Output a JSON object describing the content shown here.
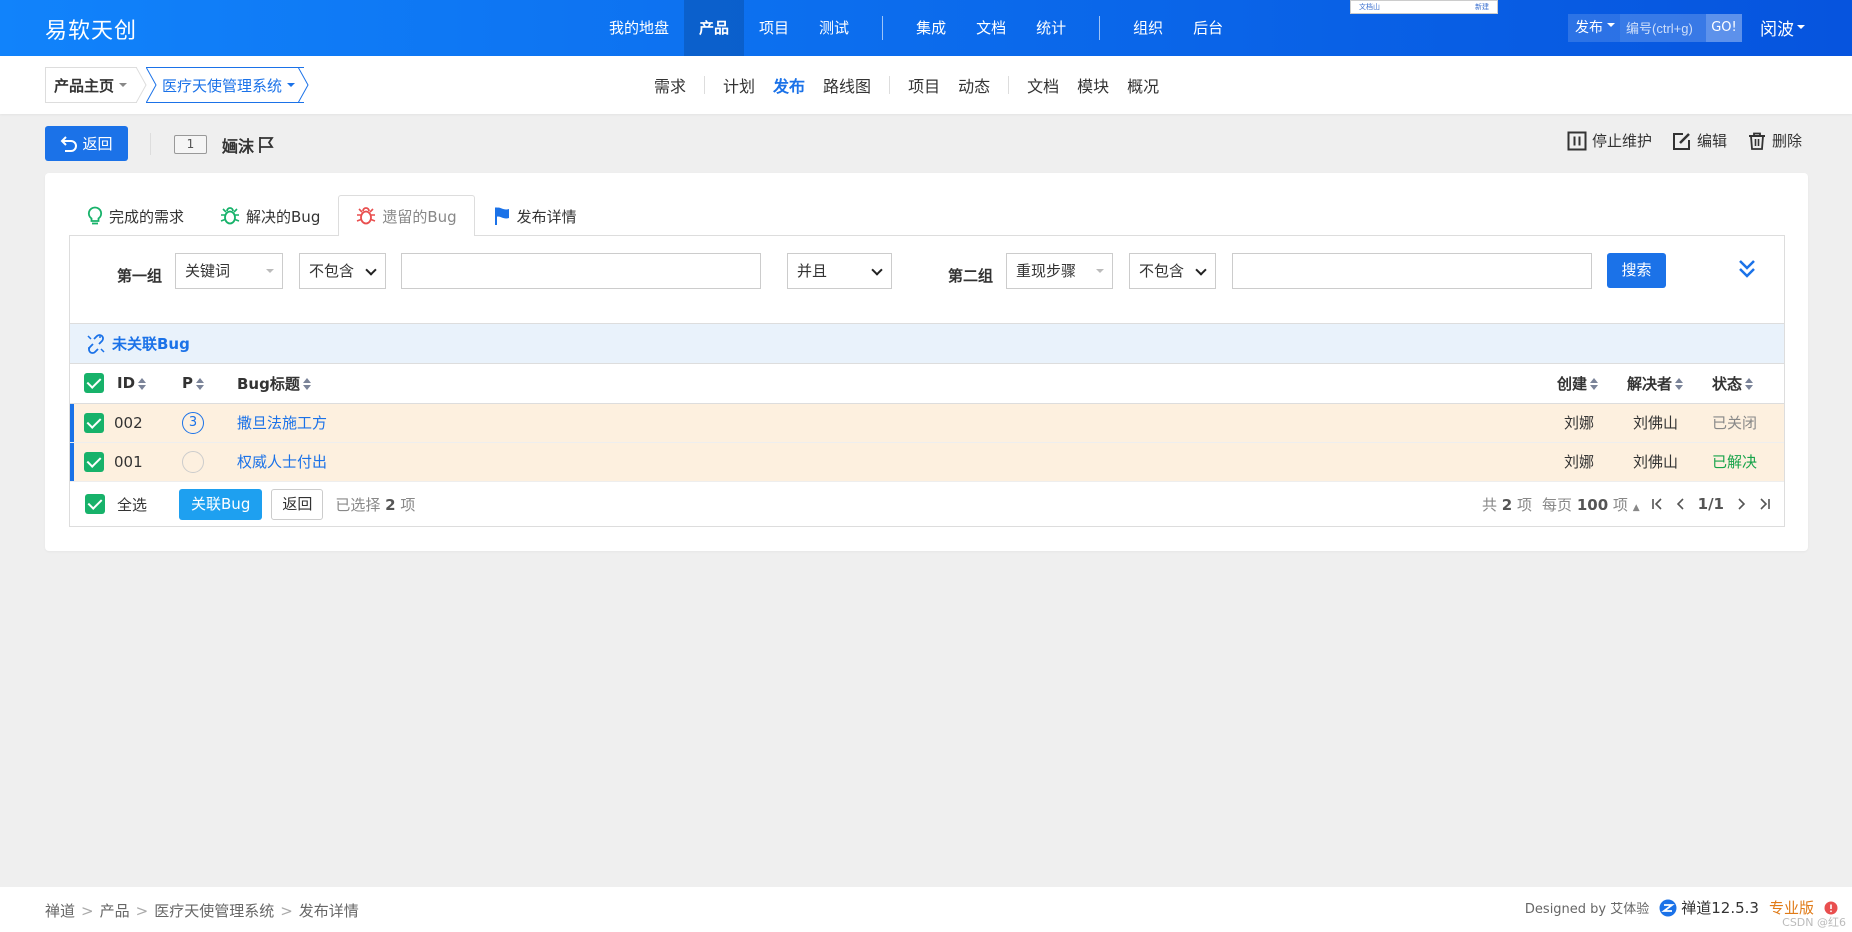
{
  "brand": "易软天创",
  "main_nav": [
    "我的地盘",
    "产品",
    "项目",
    "测试",
    "集成",
    "文档",
    "统计",
    "组织",
    "后台"
  ],
  "popup_snip": {
    "left": "文档山",
    "right": "新建"
  },
  "quick_search": {
    "type_label": "发布",
    "placeholder": "编号(ctrl+g)",
    "go_label": "GO!"
  },
  "user": "闵波",
  "crumbs": {
    "home": "产品主页",
    "product": "医疗天使管理系统"
  },
  "sub_nav": [
    "需求",
    "计划",
    "发布",
    "路线图",
    "项目",
    "动态",
    "文档",
    "模块",
    "概况"
  ],
  "toolbar": {
    "back_label": "返回",
    "release_id": "1",
    "release_name": "婳沫",
    "actions": {
      "stop": "停止维护",
      "edit": "编辑",
      "delete": "删除"
    }
  },
  "tabs": [
    "完成的需求",
    "解决的Bug",
    "遗留的Bug",
    "发布详情"
  ],
  "search": {
    "group1_label": "第一组",
    "group1_field": "关键词",
    "group1_operator": "不包含",
    "andor": "并且",
    "group2_label": "第二组",
    "group2_field": "重现步骤",
    "group2_operator": "不包含",
    "search_label": "搜索"
  },
  "group_head": "未关联Bug",
  "table": {
    "headers": {
      "id": "ID",
      "pri": "P",
      "title": "Bug标题",
      "creator": "创建",
      "resolver": "解决者",
      "status": "状态"
    },
    "rows": [
      {
        "id": "002",
        "pri": "3",
        "title": "撒旦法施工方",
        "creator": "刘娜",
        "resolver": "刘佛山",
        "status": "已关闭"
      },
      {
        "id": "001",
        "pri": "",
        "title": "权威人士付出",
        "creator": "刘娜",
        "resolver": "刘佛山",
        "status": "已解决"
      }
    ]
  },
  "footer": {
    "select_all": "全选",
    "link_label": "关联Bug",
    "back_label": "返回",
    "selected_prefix": "已选择",
    "selected_count": "2",
    "selected_suffix": "项",
    "total_prefix": "共",
    "total_count": "2",
    "total_suffix": "项",
    "per_page_prefix": "每页",
    "per_page": "100",
    "per_page_suffix": "项",
    "page": "1/1"
  },
  "statusbar": {
    "crumbs": [
      "禅道",
      "产品",
      "医疗天使管理系统",
      "发布详情"
    ],
    "designed_by": "Designed by 艾体验",
    "version": "禅道12.5.3",
    "edition": "专业版",
    "watermark": "CSDN @红6"
  }
}
